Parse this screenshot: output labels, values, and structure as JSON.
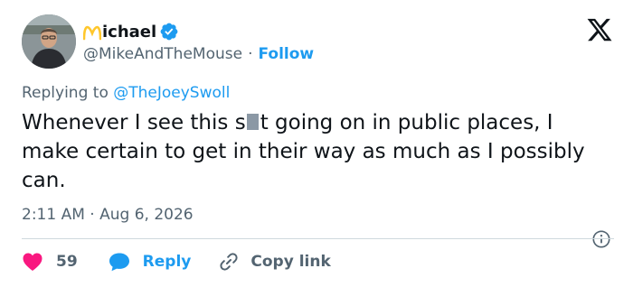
{
  "author": {
    "display_name": "ichael",
    "handle": "@MikeAndTheMouse",
    "separator": "·",
    "follow_label": "Follow"
  },
  "tweet": {
    "replying_prefix": "Replying to ",
    "replying_to": "@TheJoeySwoll",
    "text_before": "Whenever I see this s",
    "text_after": "t going on in public places, I make certain to get in their way as much as I possibly can.",
    "timestamp_time": "2:11 AM",
    "timestamp_sep": " · ",
    "timestamp_date": "Aug 6, 2026"
  },
  "actions": {
    "like_count": "59",
    "reply_label": "Reply",
    "copy_link_label": "Copy link"
  },
  "colors": {
    "accent": "#1d9bf0",
    "like": "#f91880",
    "muted": "#536471",
    "text": "#0f1419",
    "arches": "#ffc72c"
  }
}
